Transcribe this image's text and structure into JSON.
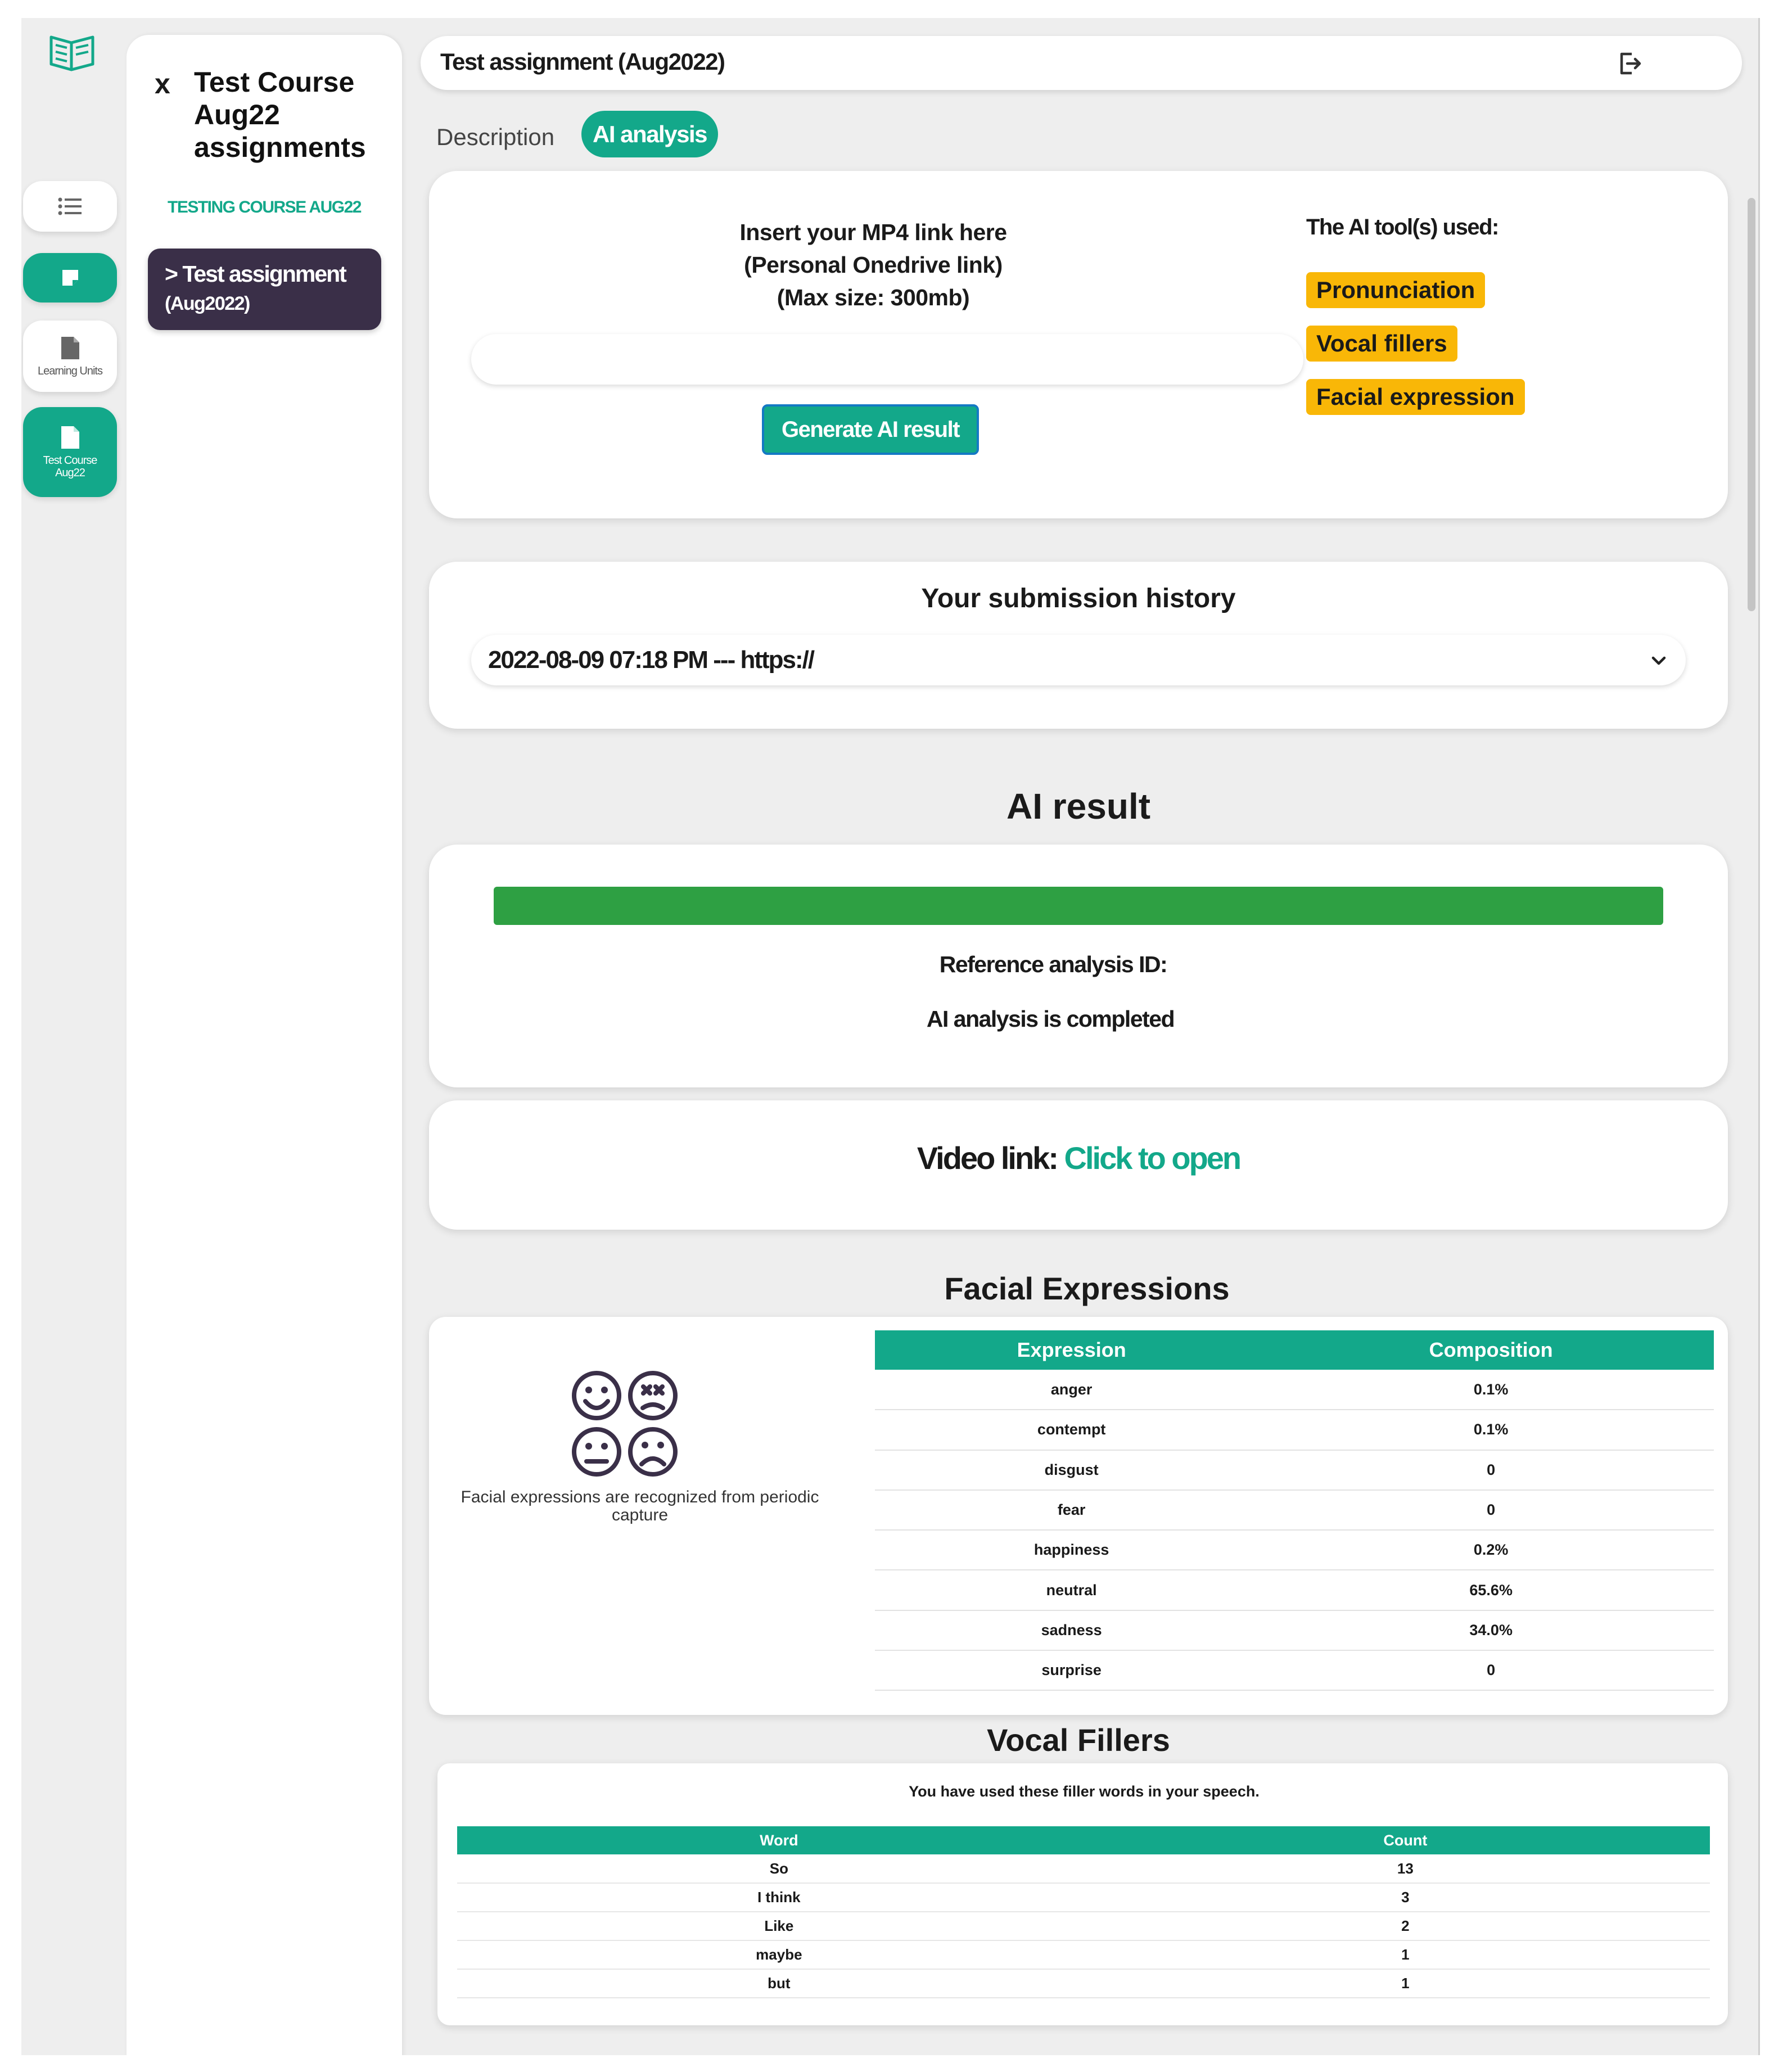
{
  "colors": {
    "accent": "#13a88a",
    "nav_dark": "#3a2f48",
    "badge": "#f9b707",
    "progress": "#2ea043"
  },
  "rail": {
    "items": [
      {
        "icon": "list-icon",
        "label": ""
      },
      {
        "icon": "note-icon",
        "label": ""
      },
      {
        "icon": "document-icon",
        "label": "Learning Units"
      },
      {
        "icon": "document-icon",
        "label": "Test Course Aug22"
      }
    ]
  },
  "course_panel": {
    "close": "x",
    "title": "Test Course Aug22 assignments",
    "subtitle": "TESTING COURSE AUG22",
    "nav_item_line1": "> Test assignment",
    "nav_item_line2": "(Aug2022)"
  },
  "header": {
    "title": "Test assignment (Aug2022)",
    "exit_icon": "logout-icon"
  },
  "tabs": [
    {
      "label": "Description",
      "active": false
    },
    {
      "label": "AI analysis",
      "active": true
    }
  ],
  "upload": {
    "line1": "Insert your MP4 link here",
    "line2": "(Personal Onedrive link)",
    "line3": "(Max size: 300mb)",
    "input_value": "",
    "button": "Generate AI result",
    "tools_label": "The AI  tool(s) used:",
    "tools": [
      "Pronunciation",
      "Vocal fillers",
      "Facial expression"
    ]
  },
  "history": {
    "title": "Your submission history",
    "selected": "2022-08-09 07:18 PM --- https://"
  },
  "result": {
    "title": "AI result",
    "progress_percent": 100,
    "reference_label": "Reference analysis ID:",
    "status": "AI analysis is completed",
    "video_label": "Video link:",
    "video_link": "Click to open"
  },
  "facial": {
    "title": "Facial Expressions",
    "caption": "Facial expressions are recognized from periodic capture",
    "headers": [
      "Expression",
      "Composition"
    ],
    "rows": [
      [
        "anger",
        "0.1%"
      ],
      [
        "contempt",
        "0.1%"
      ],
      [
        "disgust",
        "0"
      ],
      [
        "fear",
        "0"
      ],
      [
        "happiness",
        "0.2%"
      ],
      [
        "neutral",
        "65.6%"
      ],
      [
        "sadness",
        "34.0%"
      ],
      [
        "surprise",
        "0"
      ]
    ]
  },
  "vocal": {
    "title": "Vocal Fillers",
    "caption": "You have used these filler words in your speech.",
    "headers": [
      "Word",
      "Count"
    ],
    "rows": [
      [
        "So",
        "13"
      ],
      [
        "I think",
        "3"
      ],
      [
        "Like",
        "2"
      ],
      [
        "maybe",
        "1"
      ],
      [
        "but",
        "1"
      ]
    ]
  }
}
